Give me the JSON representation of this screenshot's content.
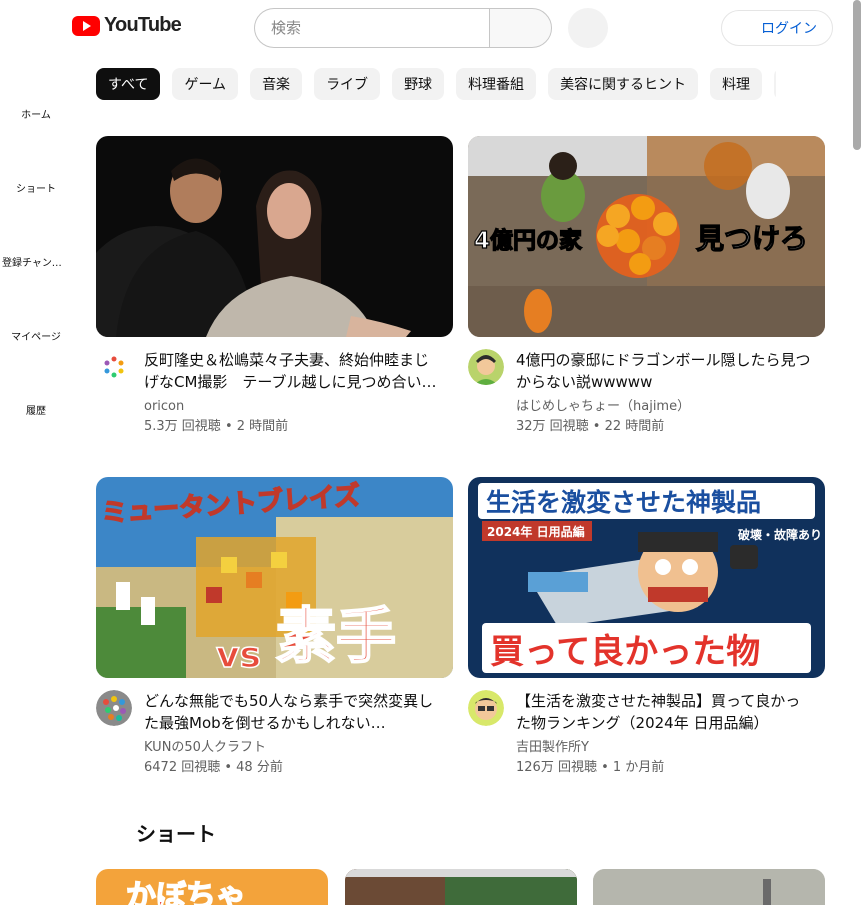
{
  "header": {
    "logo_text": "YouTube",
    "search_placeholder": "検索",
    "login_label": "ログイン"
  },
  "sidebar": {
    "items": [
      {
        "label": "ホーム",
        "icon": "home-icon"
      },
      {
        "label": "ショート",
        "icon": "shorts-icon"
      },
      {
        "label": "登録チャンネル",
        "icon": "subscriptions-icon"
      },
      {
        "label": "マイページ",
        "icon": "you-icon"
      },
      {
        "label": "履歴",
        "icon": "history-icon"
      }
    ]
  },
  "chips": [
    "すべて",
    "ゲーム",
    "音楽",
    "ライブ",
    "野球",
    "料理番組",
    "美容に関するヒント",
    "料理"
  ],
  "videos": [
    {
      "title": "反町隆史＆松嶋菜々子夫妻、終始仲睦まじげなCM撮影　テーブル越しに見つめ合い…",
      "channel": "oricon",
      "stats": "5.3万 回視聴 • 2 時間前"
    },
    {
      "title": "4億円の豪邸にドラゴンボール隠したら見つからない説wwwww",
      "channel": "はじめしゃちょー（hajime）",
      "stats": "32万 回視聴 • 22 時間前",
      "thumb_left_text": "4億円の家",
      "thumb_right_text": "見つけろ"
    },
    {
      "title": "どんな無能でも50人なら素手で突然変異した最強Mobを倒せるかもしれない…",
      "channel": "KUNの50人クラフト",
      "stats": "6472 回視聴 • 48 分前",
      "thumb_top_text": "ミュータントブレイズ",
      "thumb_vs_text": "vs",
      "thumb_bottom_text": "素手"
    },
    {
      "title": "【生活を激変させた神製品】買って良かった物ランキング（2024年 日用品編）",
      "channel": "吉田製作所Y",
      "stats": "126万 回視聴 • 1 か月前",
      "thumb_top_text": "生活を激変させた神製品",
      "thumb_badge_text": "2024年 日用品編",
      "thumb_note_text": "破壊・故障あり",
      "thumb_bottom_text": "買って良かった物"
    }
  ],
  "shorts": {
    "section_title": "ショート",
    "first_thumb_text": "かぼちゃ"
  }
}
